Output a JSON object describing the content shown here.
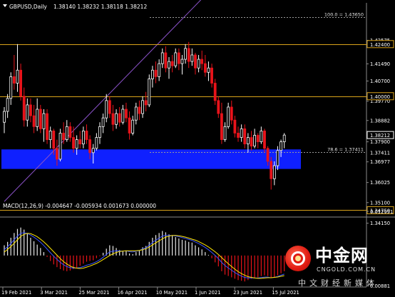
{
  "header": {
    "symbol_tf": "GBPUSD,Daily",
    "ohlc": "1.38140 1.38232 1.38118 1.38212"
  },
  "macd": {
    "label": "MACD(12,26,9) -0.004647 -0.005934 0.001673 0.000000"
  },
  "watermark": {
    "title": "中金网",
    "url": "CNGOLD.COM.CN",
    "tagline": "中文财经新媒体"
  },
  "colors": {
    "background": "#000000",
    "bull": "#ffffff",
    "bear": "#e8131a",
    "level_line": "#d9a21a",
    "zone": "#0f20ff",
    "trend": "#8b52c9",
    "macd_signal": "#ffe600",
    "macd_line": "#3b54ff",
    "text": "#ffffff"
  },
  "chart_data": [
    {
      "type": "candlestick",
      "title": "GBPUSD,Daily",
      "ylim": [
        1.345,
        1.443
      ],
      "y_ticks": [
        "1.42575",
        "1.41490",
        "1.40700",
        "1.39770",
        "1.38882",
        "1.37900",
        "1.36977",
        "1.36025",
        "1.35100",
        "1.34150"
      ],
      "x_ticks": [
        "19 Feb 2021",
        "3 Mar 2021",
        "25 Mar 2021",
        "16 Apr 2021",
        "10 May 2021",
        "1 Jun 2021",
        "23 Jun 2021",
        "15 Jul 2021"
      ],
      "price_labels": [
        {
          "text": "1.42400",
          "value": 1.424
        },
        {
          "text": "1.40000",
          "value": 1.4
        },
        {
          "text": "1.38212",
          "value": 1.38212
        },
        {
          "text": "1.37411",
          "value": 1.37411
        },
        {
          "text": "1.34750",
          "value": 1.3475
        }
      ],
      "levels": [
        {
          "value": 1.424,
          "style": "solid"
        },
        {
          "value": 1.4,
          "style": "solid"
        },
        {
          "value": 1.3475,
          "style": "solid"
        },
        {
          "value": 1.4365,
          "style": "dashed",
          "label": "100.0 = 1.43650"
        },
        {
          "value": 1.37411,
          "style": "dashed",
          "label": "78.6 = 1.37411"
        }
      ],
      "zone": {
        "from": 1.3665,
        "to": 1.3755
      },
      "trendline": {
        "from": [
          0,
          1.3515
        ],
        "to": [
          62,
          1.448
        ]
      },
      "candles": [
        {
          "o": 1.388,
          "h": 1.395,
          "l": 1.383,
          "c": 1.393
        },
        {
          "o": 1.393,
          "h": 1.401,
          "l": 1.39,
          "c": 1.399
        },
        {
          "o": 1.399,
          "h": 1.411,
          "l": 1.396,
          "c": 1.409
        },
        {
          "o": 1.409,
          "h": 1.419,
          "l": 1.403,
          "c": 1.406
        },
        {
          "o": 1.406,
          "h": 1.424,
          "l": 1.402,
          "c": 1.412
        },
        {
          "o": 1.412,
          "h": 1.415,
          "l": 1.398,
          "c": 1.4
        },
        {
          "o": 1.4,
          "h": 1.404,
          "l": 1.386,
          "c": 1.389
        },
        {
          "o": 1.389,
          "h": 1.399,
          "l": 1.386,
          "c": 1.396
        },
        {
          "o": 1.396,
          "h": 1.399,
          "l": 1.388,
          "c": 1.391
        },
        {
          "o": 1.391,
          "h": 1.396,
          "l": 1.383,
          "c": 1.386
        },
        {
          "o": 1.386,
          "h": 1.399,
          "l": 1.384,
          "c": 1.394
        },
        {
          "o": 1.394,
          "h": 1.396,
          "l": 1.383,
          "c": 1.385
        },
        {
          "o": 1.385,
          "h": 1.394,
          "l": 1.379,
          "c": 1.392
        },
        {
          "o": 1.392,
          "h": 1.394,
          "l": 1.378,
          "c": 1.38
        },
        {
          "o": 1.38,
          "h": 1.386,
          "l": 1.376,
          "c": 1.384
        },
        {
          "o": 1.384,
          "h": 1.385,
          "l": 1.373,
          "c": 1.376
        },
        {
          "o": 1.376,
          "h": 1.38,
          "l": 1.368,
          "c": 1.371
        },
        {
          "o": 1.371,
          "h": 1.385,
          "l": 1.37,
          "c": 1.383
        },
        {
          "o": 1.383,
          "h": 1.388,
          "l": 1.378,
          "c": 1.38
        },
        {
          "o": 1.38,
          "h": 1.389,
          "l": 1.379,
          "c": 1.386
        },
        {
          "o": 1.386,
          "h": 1.388,
          "l": 1.379,
          "c": 1.381
        },
        {
          "o": 1.381,
          "h": 1.386,
          "l": 1.374,
          "c": 1.376
        },
        {
          "o": 1.376,
          "h": 1.382,
          "l": 1.373,
          "c": 1.38
        },
        {
          "o": 1.38,
          "h": 1.384,
          "l": 1.376,
          "c": 1.378
        },
        {
          "o": 1.378,
          "h": 1.386,
          "l": 1.376,
          "c": 1.384
        },
        {
          "o": 1.384,
          "h": 1.387,
          "l": 1.378,
          "c": 1.38
        },
        {
          "o": 1.38,
          "h": 1.382,
          "l": 1.371,
          "c": 1.374
        },
        {
          "o": 1.374,
          "h": 1.378,
          "l": 1.369,
          "c": 1.376
        },
        {
          "o": 1.376,
          "h": 1.383,
          "l": 1.375,
          "c": 1.381
        },
        {
          "o": 1.381,
          "h": 1.388,
          "l": 1.378,
          "c": 1.386
        },
        {
          "o": 1.386,
          "h": 1.392,
          "l": 1.383,
          "c": 1.39
        },
        {
          "o": 1.39,
          "h": 1.401,
          "l": 1.388,
          "c": 1.398
        },
        {
          "o": 1.398,
          "h": 1.4,
          "l": 1.39,
          "c": 1.392
        },
        {
          "o": 1.392,
          "h": 1.396,
          "l": 1.384,
          "c": 1.387
        },
        {
          "o": 1.387,
          "h": 1.394,
          "l": 1.385,
          "c": 1.392
        },
        {
          "o": 1.392,
          "h": 1.395,
          "l": 1.386,
          "c": 1.388
        },
        {
          "o": 1.388,
          "h": 1.396,
          "l": 1.387,
          "c": 1.394
        },
        {
          "o": 1.394,
          "h": 1.397,
          "l": 1.388,
          "c": 1.39
        },
        {
          "o": 1.39,
          "h": 1.393,
          "l": 1.38,
          "c": 1.383
        },
        {
          "o": 1.383,
          "h": 1.391,
          "l": 1.382,
          "c": 1.389
        },
        {
          "o": 1.389,
          "h": 1.397,
          "l": 1.387,
          "c": 1.395
        },
        {
          "o": 1.395,
          "h": 1.398,
          "l": 1.389,
          "c": 1.392
        },
        {
          "o": 1.392,
          "h": 1.4,
          "l": 1.39,
          "c": 1.398
        },
        {
          "o": 1.398,
          "h": 1.402,
          "l": 1.393,
          "c": 1.396
        },
        {
          "o": 1.396,
          "h": 1.41,
          "l": 1.395,
          "c": 1.408
        },
        {
          "o": 1.408,
          "h": 1.414,
          "l": 1.404,
          "c": 1.412
        },
        {
          "o": 1.412,
          "h": 1.416,
          "l": 1.406,
          "c": 1.409
        },
        {
          "o": 1.409,
          "h": 1.417,
          "l": 1.407,
          "c": 1.415
        },
        {
          "o": 1.415,
          "h": 1.422,
          "l": 1.413,
          "c": 1.42
        },
        {
          "o": 1.42,
          "h": 1.423,
          "l": 1.411,
          "c": 1.413
        },
        {
          "o": 1.413,
          "h": 1.418,
          "l": 1.408,
          "c": 1.416
        },
        {
          "o": 1.416,
          "h": 1.419,
          "l": 1.411,
          "c": 1.414
        },
        {
          "o": 1.414,
          "h": 1.422,
          "l": 1.413,
          "c": 1.42
        },
        {
          "o": 1.42,
          "h": 1.422,
          "l": 1.412,
          "c": 1.415
        },
        {
          "o": 1.415,
          "h": 1.419,
          "l": 1.41,
          "c": 1.417
        },
        {
          "o": 1.417,
          "h": 1.424,
          "l": 1.415,
          "c": 1.422
        },
        {
          "o": 1.422,
          "h": 1.425,
          "l": 1.413,
          "c": 1.416
        },
        {
          "o": 1.416,
          "h": 1.422,
          "l": 1.414,
          "c": 1.419
        },
        {
          "o": 1.419,
          "h": 1.42,
          "l": 1.41,
          "c": 1.413
        },
        {
          "o": 1.413,
          "h": 1.419,
          "l": 1.411,
          "c": 1.417
        },
        {
          "o": 1.417,
          "h": 1.421,
          "l": 1.412,
          "c": 1.415
        },
        {
          "o": 1.415,
          "h": 1.419,
          "l": 1.409,
          "c": 1.411
        },
        {
          "o": 1.411,
          "h": 1.416,
          "l": 1.407,
          "c": 1.413
        },
        {
          "o": 1.413,
          "h": 1.415,
          "l": 1.404,
          "c": 1.406
        },
        {
          "o": 1.406,
          "h": 1.408,
          "l": 1.396,
          "c": 1.398
        },
        {
          "o": 1.398,
          "h": 1.4,
          "l": 1.39,
          "c": 1.392
        },
        {
          "o": 1.392,
          "h": 1.397,
          "l": 1.378,
          "c": 1.38
        },
        {
          "o": 1.38,
          "h": 1.388,
          "l": 1.379,
          "c": 1.386
        },
        {
          "o": 1.386,
          "h": 1.397,
          "l": 1.385,
          "c": 1.395
        },
        {
          "o": 1.395,
          "h": 1.398,
          "l": 1.387,
          "c": 1.389
        },
        {
          "o": 1.389,
          "h": 1.391,
          "l": 1.381,
          "c": 1.383
        },
        {
          "o": 1.383,
          "h": 1.386,
          "l": 1.379,
          "c": 1.381
        },
        {
          "o": 1.381,
          "h": 1.387,
          "l": 1.379,
          "c": 1.385
        },
        {
          "o": 1.385,
          "h": 1.387,
          "l": 1.376,
          "c": 1.378
        },
        {
          "o": 1.378,
          "h": 1.383,
          "l": 1.374,
          "c": 1.381
        },
        {
          "o": 1.381,
          "h": 1.384,
          "l": 1.375,
          "c": 1.377
        },
        {
          "o": 1.377,
          "h": 1.385,
          "l": 1.376,
          "c": 1.382
        },
        {
          "o": 1.382,
          "h": 1.383,
          "l": 1.376,
          "c": 1.379
        },
        {
          "o": 1.379,
          "h": 1.386,
          "l": 1.378,
          "c": 1.384
        },
        {
          "o": 1.384,
          "h": 1.385,
          "l": 1.374,
          "c": 1.376
        },
        {
          "o": 1.376,
          "h": 1.377,
          "l": 1.368,
          "c": 1.37
        },
        {
          "o": 1.37,
          "h": 1.372,
          "l": 1.357,
          "c": 1.362
        },
        {
          "o": 1.362,
          "h": 1.37,
          "l": 1.359,
          "c": 1.368
        },
        {
          "o": 1.368,
          "h": 1.377,
          "l": 1.366,
          "c": 1.375
        },
        {
          "o": 1.375,
          "h": 1.38,
          "l": 1.372,
          "c": 1.379
        },
        {
          "o": 1.379,
          "h": 1.383,
          "l": 1.376,
          "c": 1.3821
        }
      ]
    },
    {
      "type": "bar",
      "title": "MACD(12,26,9) -0.004647 -0.005934 0.001673 0.000000",
      "ylim": [
        -0.00881,
        0.01295
      ],
      "y_ticks": [
        "0.012951",
        "0.00881"
      ],
      "histogram": [
        0.003,
        0.004,
        0.0052,
        0.0066,
        0.0078,
        0.0082,
        0.0076,
        0.0064,
        0.0052,
        0.0042,
        0.0032,
        0.0022,
        0.001,
        -0.0004,
        -0.0016,
        -0.0026,
        -0.0034,
        -0.004,
        -0.0044,
        -0.0046,
        -0.0044,
        -0.004,
        -0.0036,
        -0.003,
        -0.0024,
        -0.0018,
        -0.0016,
        -0.0014,
        -0.0008,
        -0.0002,
        0.0008,
        0.002,
        0.003,
        0.0028,
        0.0022,
        0.0016,
        0.0012,
        0.0014,
        0.0006,
        0.0004,
        0.001,
        0.0014,
        0.0024,
        0.0028,
        0.004,
        0.0052,
        0.006,
        0.0066,
        0.0072,
        0.0068,
        0.0062,
        0.0058,
        0.0054,
        0.005,
        0.0046,
        0.0044,
        0.004,
        0.0038,
        0.003,
        0.0024,
        0.0018,
        0.001,
        0.0002,
        -0.0008,
        -0.002,
        -0.0032,
        -0.0046,
        -0.0056,
        -0.006,
        -0.0064,
        -0.0068,
        -0.0072,
        -0.0074,
        -0.0076,
        -0.0072,
        -0.0068,
        -0.0066,
        -0.0064,
        -0.006,
        -0.0058,
        -0.006,
        -0.0066,
        -0.0064,
        -0.0058,
        -0.0052,
        -0.0046
      ],
      "signal": [
        0.001,
        0.0018,
        0.0026,
        0.0036,
        0.0046,
        0.0056,
        0.0062,
        0.0065,
        0.0064,
        0.006,
        0.0055,
        0.0048,
        0.004,
        0.0031,
        0.0021,
        0.0011,
        0.0001,
        -0.0009,
        -0.0018,
        -0.0025,
        -0.0031,
        -0.0035,
        -0.0037,
        -0.0038,
        -0.0037,
        -0.0034,
        -0.0031,
        -0.0027,
        -0.0023,
        -0.0018,
        -0.0012,
        -0.0006,
        0.0,
        0.0005,
        0.0009,
        0.0012,
        0.0013,
        0.0014,
        0.0014,
        0.0014,
        0.0014,
        0.0015,
        0.0017,
        0.002,
        0.0025,
        0.0031,
        0.0037,
        0.0043,
        0.0049,
        0.0054,
        0.0057,
        0.0059,
        0.0059,
        0.0058,
        0.0056,
        0.0054,
        0.0051,
        0.0048,
        0.0045,
        0.0041,
        0.0036,
        0.0031,
        0.0025,
        0.0018,
        0.0011,
        0.0003,
        -0.0006,
        -0.0015,
        -0.0024,
        -0.0032,
        -0.004,
        -0.0047,
        -0.0053,
        -0.0058,
        -0.0062,
        -0.0064,
        -0.0066,
        -0.0067,
        -0.0067,
        -0.0066,
        -0.0065,
        -0.0065,
        -0.0064,
        -0.0063,
        -0.0061,
        -0.0059
      ]
    }
  ]
}
